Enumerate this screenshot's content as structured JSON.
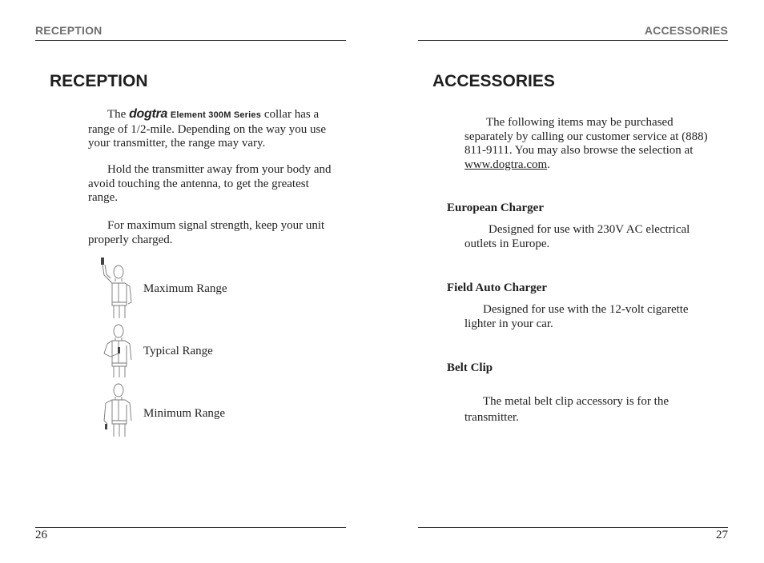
{
  "left_page": {
    "running_header": "RECEPTION",
    "title": "RECEPTION",
    "paragraphs": {
      "p1_prefix": "The",
      "brand": "dogtra",
      "model": "Element 300M Series",
      "p1_suffix": "collar has a range of 1/2-mile. Depending on the way you use your transmitter, the range may vary.",
      "p2": "Hold the transmitter away from your body and avoid touching the antenna, to get the greatest range.",
      "p3": "For maximum signal strength, keep your unit properly charged."
    },
    "figures": [
      {
        "label": "Maximum Range",
        "icon": "person-arm-raised-icon"
      },
      {
        "label": "Typical Range",
        "icon": "person-chest-height-icon"
      },
      {
        "label": "Minimum Range",
        "icon": "person-arm-down-icon"
      }
    ],
    "page_number": "26"
  },
  "right_page": {
    "running_header": "ACCESSORIES",
    "title": "ACCESSORIES",
    "intro_prefix": "The following items may be purchased separately by calling our customer service at (888) 811-9111. You may also browse the selection at",
    "intro_link": "www.dogtra.com",
    "intro_suffix": ".",
    "items": [
      {
        "name": "European Charger",
        "description": "Designed for use with 230V AC electrical outlets in Europe."
      },
      {
        "name": "Field Auto Charger",
        "description": "Designed for use with the 12-volt cigarette lighter in your car."
      },
      {
        "name": "Belt Clip",
        "description": "The metal belt clip accessory is for the transmitter."
      }
    ],
    "page_number": "27"
  }
}
